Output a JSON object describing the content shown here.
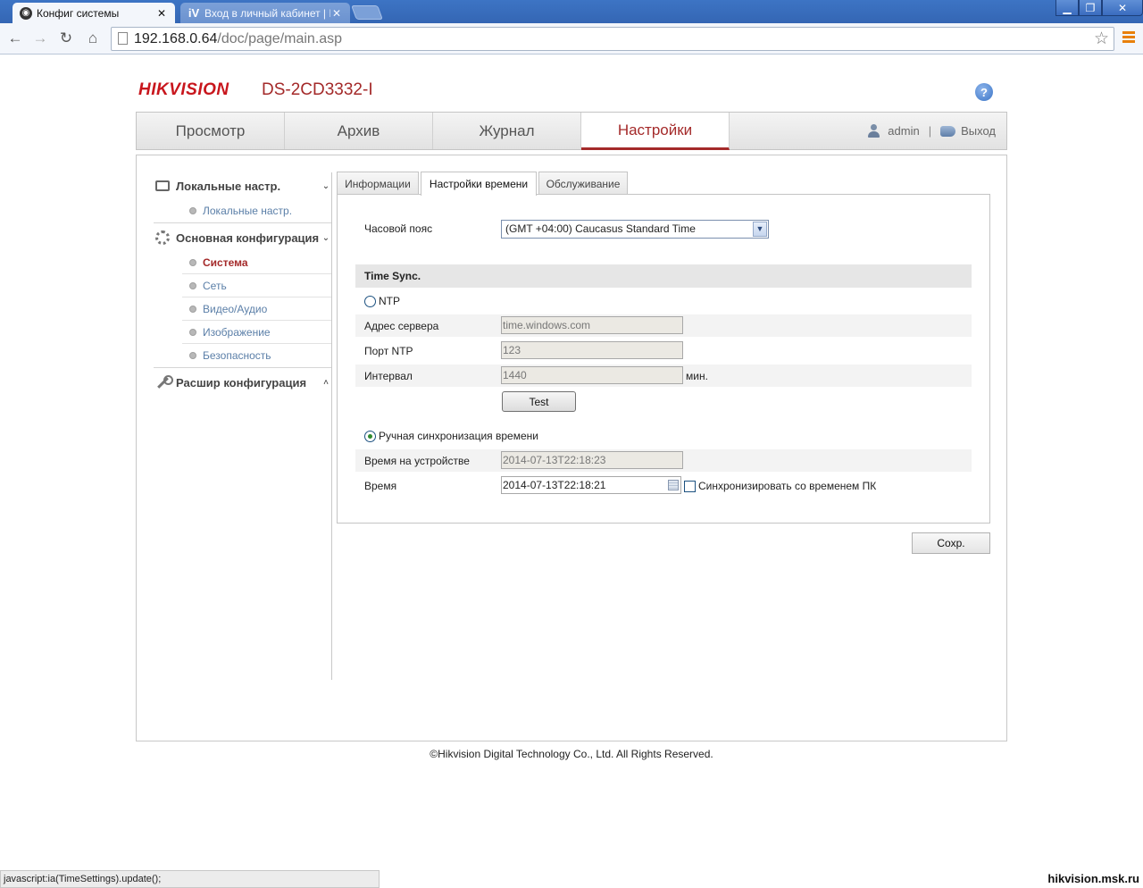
{
  "browser": {
    "tabs": [
      {
        "label": "Конфиг системы",
        "favicon": "camera-icon",
        "active": true
      },
      {
        "label": "Вход в личный кабинет | Iv",
        "favicon": "iv-icon",
        "favicon_text": "iV",
        "active": false
      }
    ],
    "url_host": "192.168.0.64",
    "url_path": "/doc/page/main.asp",
    "window_controls": {
      "minimize": "▁",
      "restore": "❐",
      "close": "✕"
    }
  },
  "header": {
    "logo": "HIKVISION",
    "model": "DS-2CD3332-I",
    "help": "?"
  },
  "mainnav": {
    "tabs": [
      "Просмотр",
      "Архив",
      "Журнал",
      "Настройки"
    ],
    "active_index": 3,
    "user": "admin",
    "separator": "|",
    "logout": "Выход"
  },
  "sidebar": {
    "groups": [
      {
        "label": "Локальные настр.",
        "arrow": "⌄",
        "items": [
          "Локальные настр."
        ]
      },
      {
        "label": "Основная конфигурация",
        "arrow": "⌄",
        "items": [
          "Система",
          "Сеть",
          "Видео/Аудио",
          "Изображение",
          "Безопасность"
        ],
        "active_item": 0
      },
      {
        "label": "Расшир конфигурация",
        "arrow": "˄",
        "items": []
      }
    ]
  },
  "subtabs": [
    "Информации",
    "Настройки времени",
    "Обслуживание"
  ],
  "form": {
    "timezone_label": "Часовой пояс",
    "timezone_value": "(GMT +04:00) Caucasus Standard Time",
    "section_title": "Time Sync.",
    "ntp_label": "NTP",
    "server_label": "Адрес сервера",
    "server_value": "time.windows.com",
    "port_label": "Порт NTP",
    "port_value": "123",
    "interval_label": "Интервал",
    "interval_value": "1440",
    "interval_unit": "мин.",
    "test_button": "Test",
    "manual_label": "Ручная синхронизация времени",
    "device_time_label": "Время на устройстве",
    "device_time_value": "2014-07-13T22:18:23",
    "time_label": "Время",
    "time_value": "2014-07-13T22:18:21",
    "sync_pc_label": "Синхронизировать со временем ПК",
    "save_button": "Сохр."
  },
  "footer": "©Hikvision Digital Technology Co., Ltd. All Rights Reserved.",
  "statusbar": "javascript:ia(TimeSettings).update();",
  "watermark": "hikvision.msk.ru",
  "colors": {
    "brand_red": "#c8161d",
    "accent": "#a42a2a",
    "link": "#5b7fa8"
  }
}
